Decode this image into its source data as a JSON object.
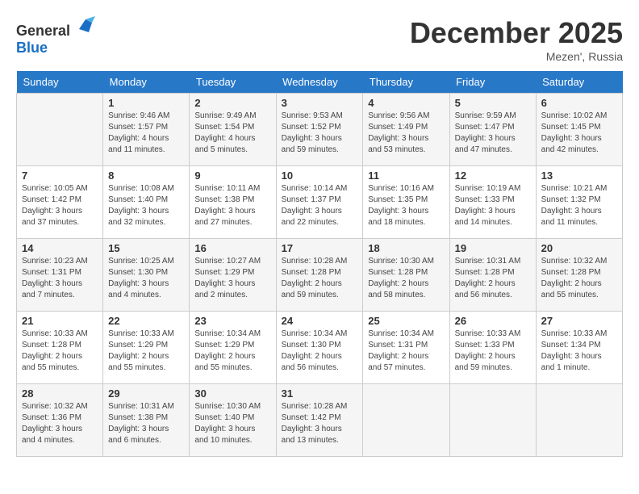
{
  "header": {
    "logo_general": "General",
    "logo_blue": "Blue",
    "title": "December 2025",
    "location": "Mezen', Russia"
  },
  "weekdays": [
    "Sunday",
    "Monday",
    "Tuesday",
    "Wednesday",
    "Thursday",
    "Friday",
    "Saturday"
  ],
  "weeks": [
    [
      {
        "day": "",
        "info": ""
      },
      {
        "day": "1",
        "info": "Sunrise: 9:46 AM\nSunset: 1:57 PM\nDaylight: 4 hours\nand 11 minutes."
      },
      {
        "day": "2",
        "info": "Sunrise: 9:49 AM\nSunset: 1:54 PM\nDaylight: 4 hours\nand 5 minutes."
      },
      {
        "day": "3",
        "info": "Sunrise: 9:53 AM\nSunset: 1:52 PM\nDaylight: 3 hours\nand 59 minutes."
      },
      {
        "day": "4",
        "info": "Sunrise: 9:56 AM\nSunset: 1:49 PM\nDaylight: 3 hours\nand 53 minutes."
      },
      {
        "day": "5",
        "info": "Sunrise: 9:59 AM\nSunset: 1:47 PM\nDaylight: 3 hours\nand 47 minutes."
      },
      {
        "day": "6",
        "info": "Sunrise: 10:02 AM\nSunset: 1:45 PM\nDaylight: 3 hours\nand 42 minutes."
      }
    ],
    [
      {
        "day": "7",
        "info": "Sunrise: 10:05 AM\nSunset: 1:42 PM\nDaylight: 3 hours\nand 37 minutes."
      },
      {
        "day": "8",
        "info": "Sunrise: 10:08 AM\nSunset: 1:40 PM\nDaylight: 3 hours\nand 32 minutes."
      },
      {
        "day": "9",
        "info": "Sunrise: 10:11 AM\nSunset: 1:38 PM\nDaylight: 3 hours\nand 27 minutes."
      },
      {
        "day": "10",
        "info": "Sunrise: 10:14 AM\nSunset: 1:37 PM\nDaylight: 3 hours\nand 22 minutes."
      },
      {
        "day": "11",
        "info": "Sunrise: 10:16 AM\nSunset: 1:35 PM\nDaylight: 3 hours\nand 18 minutes."
      },
      {
        "day": "12",
        "info": "Sunrise: 10:19 AM\nSunset: 1:33 PM\nDaylight: 3 hours\nand 14 minutes."
      },
      {
        "day": "13",
        "info": "Sunrise: 10:21 AM\nSunset: 1:32 PM\nDaylight: 3 hours\nand 11 minutes."
      }
    ],
    [
      {
        "day": "14",
        "info": "Sunrise: 10:23 AM\nSunset: 1:31 PM\nDaylight: 3 hours\nand 7 minutes."
      },
      {
        "day": "15",
        "info": "Sunrise: 10:25 AM\nSunset: 1:30 PM\nDaylight: 3 hours\nand 4 minutes."
      },
      {
        "day": "16",
        "info": "Sunrise: 10:27 AM\nSunset: 1:29 PM\nDaylight: 3 hours\nand 2 minutes."
      },
      {
        "day": "17",
        "info": "Sunrise: 10:28 AM\nSunset: 1:28 PM\nDaylight: 2 hours\nand 59 minutes."
      },
      {
        "day": "18",
        "info": "Sunrise: 10:30 AM\nSunset: 1:28 PM\nDaylight: 2 hours\nand 58 minutes."
      },
      {
        "day": "19",
        "info": "Sunrise: 10:31 AM\nSunset: 1:28 PM\nDaylight: 2 hours\nand 56 minutes."
      },
      {
        "day": "20",
        "info": "Sunrise: 10:32 AM\nSunset: 1:28 PM\nDaylight: 2 hours\nand 55 minutes."
      }
    ],
    [
      {
        "day": "21",
        "info": "Sunrise: 10:33 AM\nSunset: 1:28 PM\nDaylight: 2 hours\nand 55 minutes."
      },
      {
        "day": "22",
        "info": "Sunrise: 10:33 AM\nSunset: 1:29 PM\nDaylight: 2 hours\nand 55 minutes."
      },
      {
        "day": "23",
        "info": "Sunrise: 10:34 AM\nSunset: 1:29 PM\nDaylight: 2 hours\nand 55 minutes."
      },
      {
        "day": "24",
        "info": "Sunrise: 10:34 AM\nSunset: 1:30 PM\nDaylight: 2 hours\nand 56 minutes."
      },
      {
        "day": "25",
        "info": "Sunrise: 10:34 AM\nSunset: 1:31 PM\nDaylight: 2 hours\nand 57 minutes."
      },
      {
        "day": "26",
        "info": "Sunrise: 10:33 AM\nSunset: 1:33 PM\nDaylight: 2 hours\nand 59 minutes."
      },
      {
        "day": "27",
        "info": "Sunrise: 10:33 AM\nSunset: 1:34 PM\nDaylight: 3 hours\nand 1 minute."
      }
    ],
    [
      {
        "day": "28",
        "info": "Sunrise: 10:32 AM\nSunset: 1:36 PM\nDaylight: 3 hours\nand 4 minutes."
      },
      {
        "day": "29",
        "info": "Sunrise: 10:31 AM\nSunset: 1:38 PM\nDaylight: 3 hours\nand 6 minutes."
      },
      {
        "day": "30",
        "info": "Sunrise: 10:30 AM\nSunset: 1:40 PM\nDaylight: 3 hours\nand 10 minutes."
      },
      {
        "day": "31",
        "info": "Sunrise: 10:28 AM\nSunset: 1:42 PM\nDaylight: 3 hours\nand 13 minutes."
      },
      {
        "day": "",
        "info": ""
      },
      {
        "day": "",
        "info": ""
      },
      {
        "day": "",
        "info": ""
      }
    ]
  ]
}
